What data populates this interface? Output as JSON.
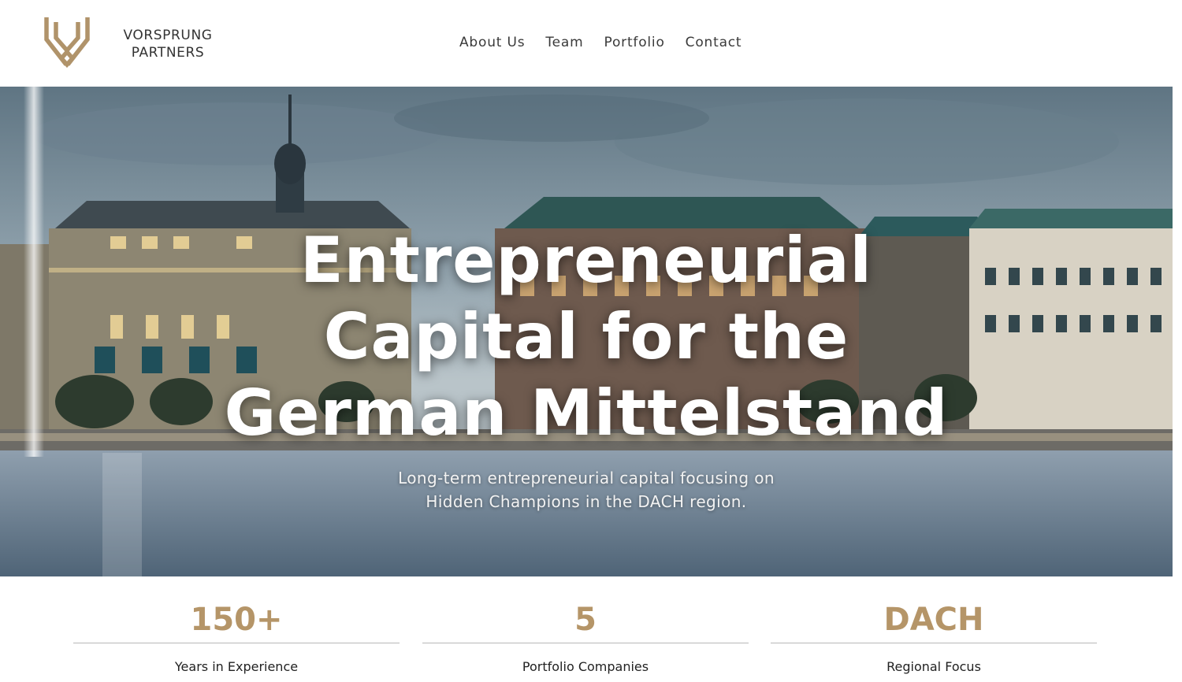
{
  "brand": {
    "line1": "VORSPRUNG",
    "line2": "PARTNERS",
    "logo_icon": "vp-chevron-logo-icon",
    "logo_color": "#b0936a"
  },
  "nav": {
    "items": [
      {
        "label": "About Us"
      },
      {
        "label": "Team"
      },
      {
        "label": "Portfolio"
      },
      {
        "label": "Contact"
      }
    ]
  },
  "hero": {
    "title_lines": [
      "Entrepreneurial",
      "Capital for the",
      "German Mittelstand"
    ],
    "subtitle_lines": [
      "Long-term entrepreneurial capital focusing on",
      "Hidden Champions in the DACH region."
    ]
  },
  "stats": [
    {
      "value": "150+",
      "label": "Years in Experience"
    },
    {
      "value": "5",
      "label": "Portfolio Companies"
    },
    {
      "value": "DACH",
      "label": "Regional Focus"
    }
  ],
  "colors": {
    "accent": "#b59568",
    "text": "#222222"
  }
}
